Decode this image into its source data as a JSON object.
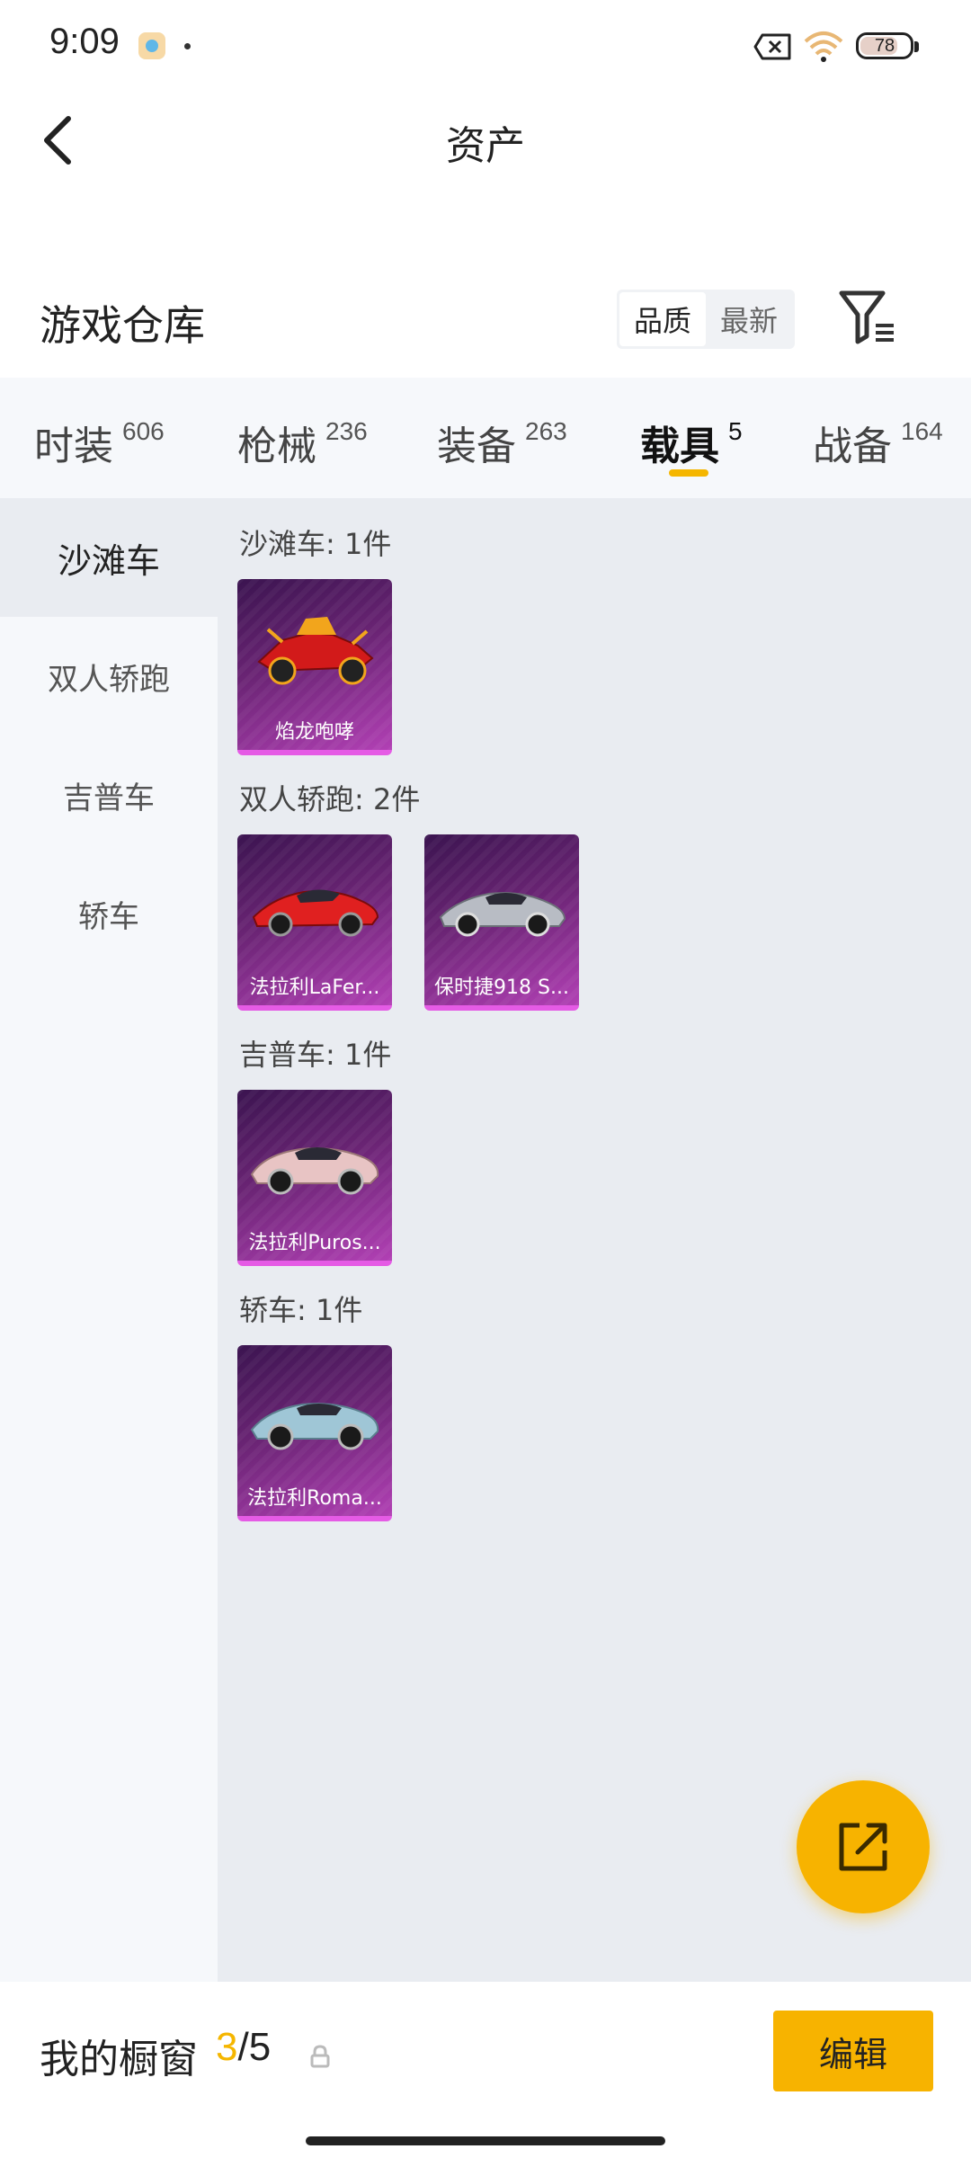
{
  "status_bar": {
    "time": "9:09",
    "battery": "78"
  },
  "nav": {
    "title": "资产"
  },
  "warehouse": {
    "title": "游戏仓库",
    "sort_options": [
      {
        "label": "品质",
        "active": true
      },
      {
        "label": "最新",
        "active": false
      }
    ]
  },
  "categories": [
    {
      "label": "时装",
      "count": "606",
      "active": false
    },
    {
      "label": "枪械",
      "count": "236",
      "active": false
    },
    {
      "label": "装备",
      "count": "263",
      "active": false
    },
    {
      "label": "载具",
      "count": "5",
      "active": true
    },
    {
      "label": "战备",
      "count": "164",
      "active": false
    }
  ],
  "sidebar": {
    "items": [
      {
        "label": "沙滩车",
        "active": true
      },
      {
        "label": "双人轿跑",
        "active": false
      },
      {
        "label": "吉普车",
        "active": false
      },
      {
        "label": "轿车",
        "active": false
      }
    ]
  },
  "sections": [
    {
      "title": "沙滩车: 1件",
      "items": [
        {
          "name": "焰龙咆哮",
          "icon": "dune-buggy-icon",
          "color": "#d21a1a"
        }
      ]
    },
    {
      "title": "双人轿跑: 2件",
      "items": [
        {
          "name": "法拉利LaFer...",
          "icon": "red-sports-car-icon",
          "color": "#e02020"
        },
        {
          "name": "保时捷918 S...",
          "icon": "silver-sports-car-icon",
          "color": "#b8bcc4"
        }
      ]
    },
    {
      "title": "吉普车: 1件",
      "items": [
        {
          "name": "法拉利Puros...",
          "icon": "pink-suv-icon",
          "color": "#e8c4c4"
        }
      ]
    },
    {
      "title": "轿车: 1件",
      "items": [
        {
          "name": "法拉利Roma...",
          "icon": "light-blue-coupe-icon",
          "color": "#9fc6d6"
        }
      ]
    }
  ],
  "showcase": {
    "label": "我的橱窗",
    "current": "3",
    "separator": "/",
    "total": "5",
    "edit_label": "编辑"
  },
  "colors": {
    "accent": "#f7b300",
    "card_border": "#e55be5"
  }
}
